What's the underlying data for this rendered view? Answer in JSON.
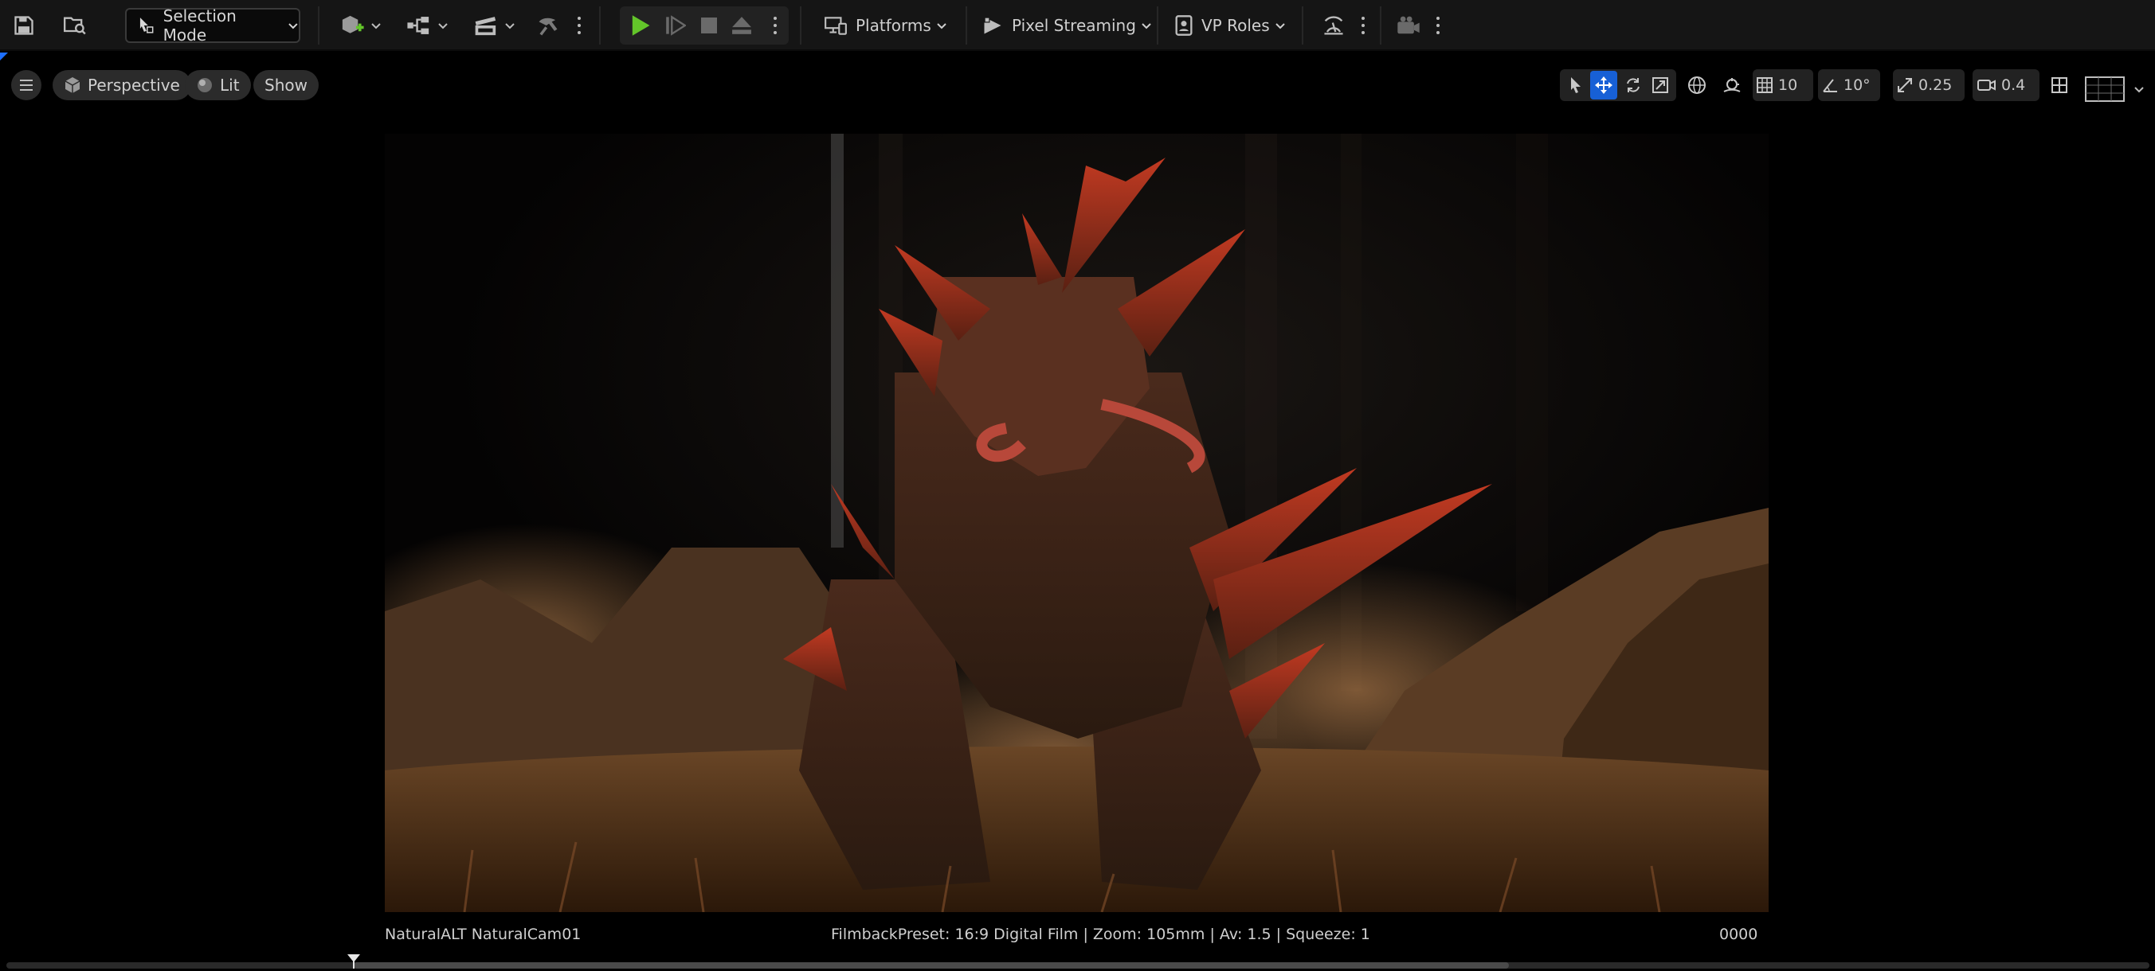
{
  "toolbar": {
    "selection_mode_label": "Selection Mode",
    "platforms_label": "Platforms",
    "pixel_streaming_label": "Pixel Streaming",
    "vp_roles_label": "VP Roles"
  },
  "viewport_toolbar": {
    "perspective_label": "Perspective",
    "lit_label": "Lit",
    "show_label": "Show",
    "grid_snap_value": "10",
    "rotation_snap_value": "10°",
    "scale_snap_value": "0.25",
    "camera_speed_value": "0.4"
  },
  "viewport": {
    "camera_name": "NaturalALT NaturalCam01",
    "filmback_info": "FilmbackPreset: 16:9 Digital Film | Zoom: 105mm | Av: 1.5 | Squeeze: 1",
    "frame_counter": "0000"
  },
  "colors": {
    "accent": "#1760d6",
    "play_green": "#63c52a",
    "toolbar_bg": "#151515"
  },
  "icons": [
    "save-icon",
    "browse-icon",
    "selection-cursor-icon",
    "add-actor-icon",
    "blueprint-icon",
    "cinematics-icon",
    "build-icon",
    "play-icon",
    "step-icon",
    "stop-icon",
    "eject-icon",
    "platforms-icon",
    "pixel-streaming-icon",
    "vp-roles-icon",
    "live-link-icon",
    "camera-icon",
    "hamburger-icon",
    "perspective-cube-icon",
    "lit-sphere-icon",
    "select-tool-icon",
    "move-tool-icon",
    "rotate-tool-icon",
    "scale-tool-icon",
    "world-coords-icon",
    "surface-snap-icon",
    "grid-icon",
    "angle-icon",
    "scale-snap-icon",
    "camera-speed-icon",
    "layout-icon",
    "viewport-options-icon"
  ]
}
